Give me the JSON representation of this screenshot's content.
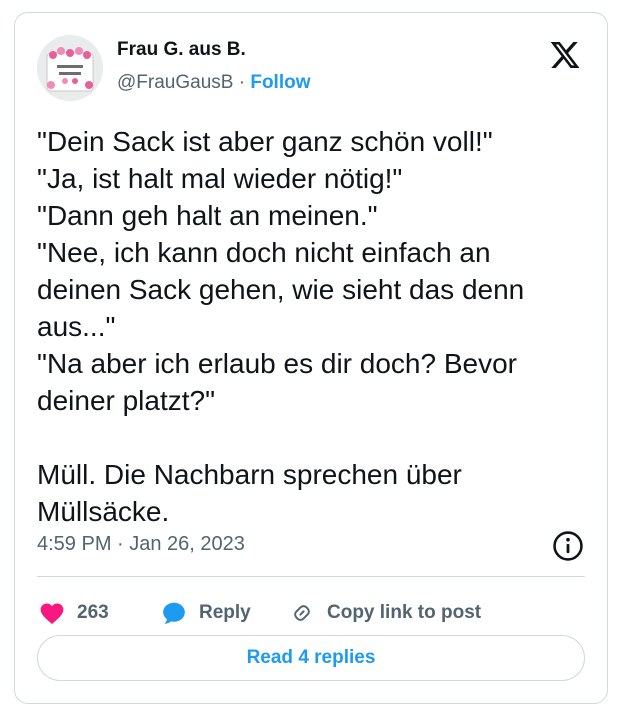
{
  "tweet": {
    "author_name": "Frau G. aus B.",
    "handle": "@FrauGausB",
    "separator": " · ",
    "follow_label": "Follow",
    "body_lines": [
      "\"Dein Sack ist aber ganz schön voll!\"",
      "\"Ja, ist halt mal wieder nötig!\"",
      "\"Dann geh halt an meinen.\"",
      "\"Nee, ich kann doch nicht einfach an deinen Sack gehen, wie sieht das denn aus...\"",
      "\"Na aber ich erlaub es dir doch? Bevor deiner platzt?\"",
      "",
      "Müll. Die Nachbarn sprechen über Müllsäcke."
    ],
    "timestamp": "4:59 PM · Jan 26, 2023"
  },
  "actions": {
    "like_count": "263",
    "reply_label": "Reply",
    "copy_label": "Copy link to post"
  },
  "replies_button": "Read 4 replies",
  "icons": {
    "logo": "x-logo-icon",
    "info": "info-icon",
    "like": "heart-icon",
    "reply": "speech-bubble-icon",
    "copy": "link-icon"
  },
  "colors": {
    "accent": "#1d9bf0",
    "heart": "#f91880",
    "muted": "#536471",
    "border": "#cfd9de"
  }
}
